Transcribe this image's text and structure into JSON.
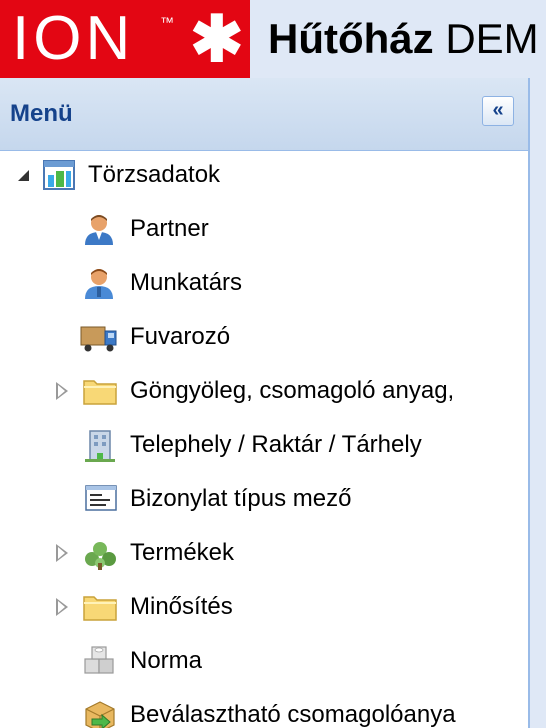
{
  "header": {
    "logo_text": "ION",
    "logo_tm": "™",
    "logo_symbol": "✱",
    "title_bold": "Hűtőház",
    "title_rest": "DEM"
  },
  "menu": {
    "title": "Menü",
    "collapse_button": "«",
    "tree": [
      {
        "label": "Törzsadatok",
        "icon": "grid-data-icon",
        "expander": "expanded",
        "level": 0
      },
      {
        "label": "Partner",
        "icon": "partner-person-icon",
        "expander": "none",
        "level": 1
      },
      {
        "label": "Munkatárs",
        "icon": "employee-person-icon",
        "expander": "none",
        "level": 1
      },
      {
        "label": "Fuvarozó",
        "icon": "truck-icon",
        "expander": "none",
        "level": 1
      },
      {
        "label": "Göngyöleg, csomagoló anyag,",
        "icon": "folder-icon",
        "expander": "collapsed",
        "level": 1
      },
      {
        "label": "Telephely / Raktár / Tárhely",
        "icon": "building-icon",
        "expander": "none",
        "level": 1
      },
      {
        "label": "Bizonylat típus mező",
        "icon": "form-field-icon",
        "expander": "none",
        "level": 1
      },
      {
        "label": "Termékek",
        "icon": "plant-icon",
        "expander": "collapsed",
        "level": 1
      },
      {
        "label": "Minősítés",
        "icon": "folder-icon",
        "expander": "collapsed",
        "level": 1
      },
      {
        "label": "Norma",
        "icon": "blocks-icon",
        "expander": "none",
        "level": 1
      },
      {
        "label": "Beválasztható csomagolóanya",
        "icon": "package-arrow-icon",
        "expander": "none",
        "level": 1
      }
    ]
  },
  "colors": {
    "brand_red": "#e30613",
    "panel_header": "#c5d7ed",
    "panel_title": "#15428b",
    "border": "#99bbe8"
  }
}
